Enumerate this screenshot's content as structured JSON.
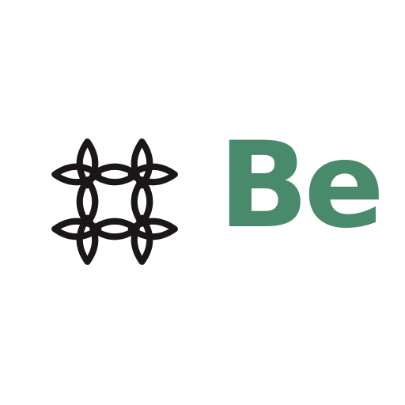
{
  "brand": {
    "wordmark": "Be",
    "wordmark_color": "#4A8A6C",
    "mark_color": "#1B1718",
    "background": "#FFFFFF",
    "mark_icon": "interlaced-petal-lattice-icon"
  }
}
